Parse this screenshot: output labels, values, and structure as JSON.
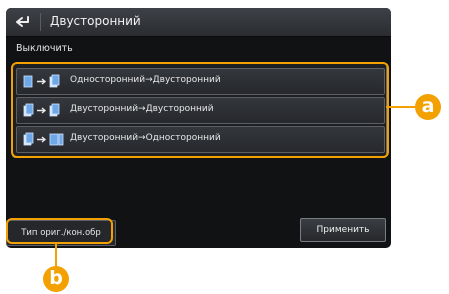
{
  "header": {
    "title": "Двусторонний"
  },
  "off_label": "Выключить",
  "options": [
    {
      "label": "Односторонний→Двусторонний",
      "icon": "one-to-two-sided-icon"
    },
    {
      "label": "Двусторонний→Двусторонний",
      "icon": "two-to-two-sided-icon"
    },
    {
      "label": "Двусторонний→Односторонний",
      "icon": "two-to-one-sided-icon"
    }
  ],
  "footer": {
    "orig_type_label": "Тип ориг./кон.обр",
    "apply_label": "Применить"
  },
  "callouts": {
    "a": "a",
    "b": "b"
  },
  "colors": {
    "callout": "#f2a100"
  }
}
